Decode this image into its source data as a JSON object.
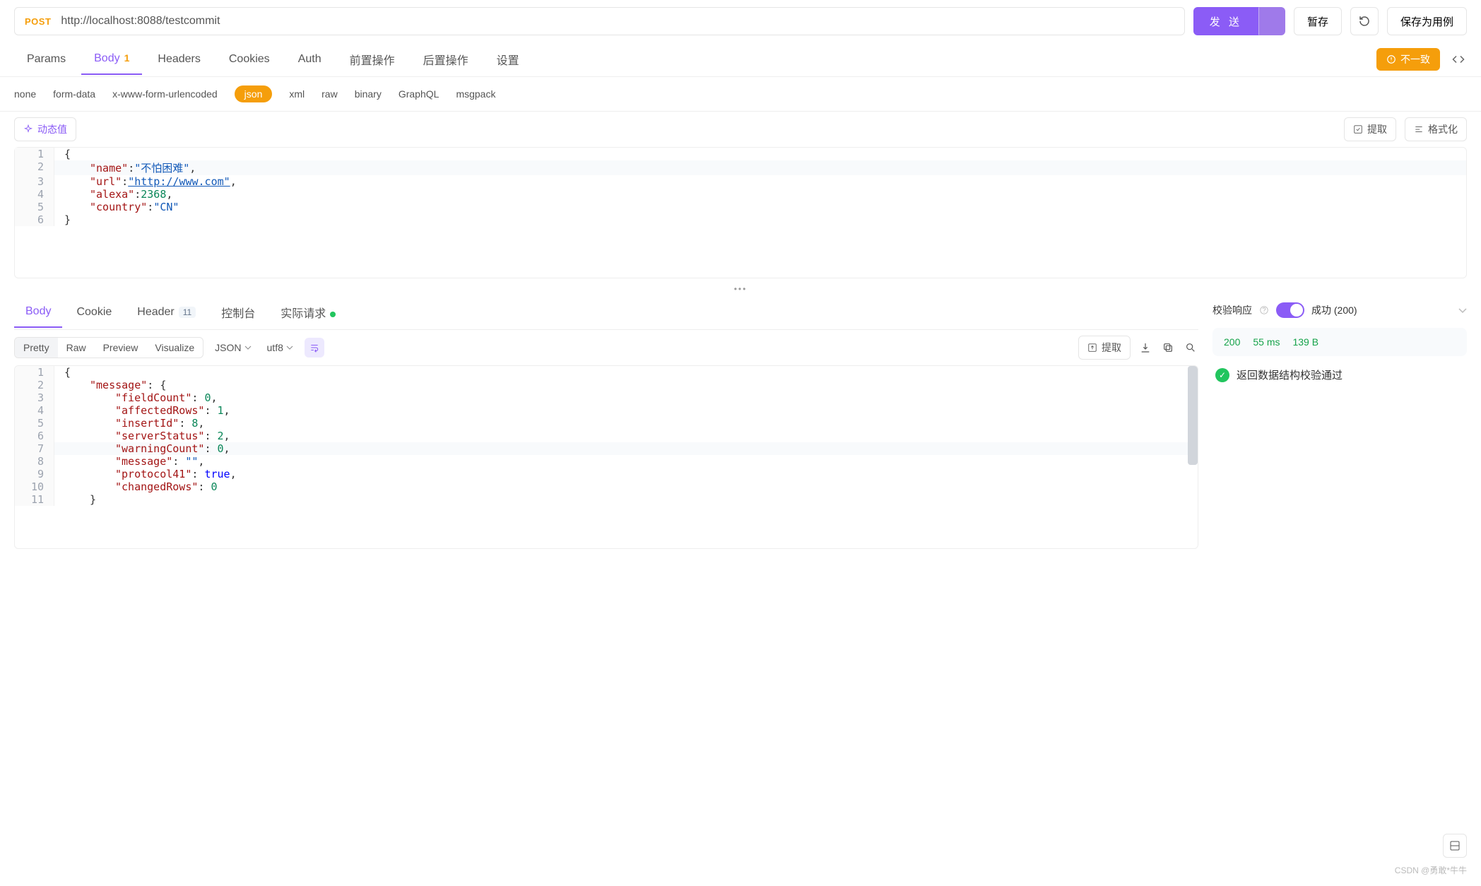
{
  "request": {
    "method": "POST",
    "url": "http://localhost:8088/testcommit"
  },
  "actions": {
    "send": "发 送",
    "save_draft": "暂存",
    "save_case": "保存为用例"
  },
  "reqTabs": {
    "params": "Params",
    "body": "Body",
    "body_badge": "1",
    "headers": "Headers",
    "cookies": "Cookies",
    "auth": "Auth",
    "pre": "前置操作",
    "post": "后置操作",
    "settings": "设置"
  },
  "warn_pill": "不一致",
  "bodyTypes": {
    "none": "none",
    "formdata": "form-data",
    "urlenc": "x-www-form-urlencoded",
    "json": "json",
    "xml": "xml",
    "raw": "raw",
    "binary": "binary",
    "graphql": "GraphQL",
    "msgpack": "msgpack"
  },
  "toolbar": {
    "dynamic": "动态值",
    "extract": "提取",
    "format": "格式化"
  },
  "reqBodyLines": [
    {
      "n": 1,
      "ind": 0,
      "tokens": [
        [
          "p",
          "{"
        ]
      ]
    },
    {
      "n": 2,
      "ind": 1,
      "hl": true,
      "tokens": [
        [
          "k",
          "\"name\""
        ],
        [
          "p",
          ":"
        ],
        [
          "s",
          "\"不怕困难\""
        ],
        [
          "p",
          ","
        ]
      ]
    },
    {
      "n": 3,
      "ind": 1,
      "tokens": [
        [
          "k",
          "\"url\""
        ],
        [
          "p",
          ":"
        ],
        [
          "s",
          "\"http://www.com\""
        ],
        [
          "p",
          ","
        ]
      ],
      "ul": true
    },
    {
      "n": 4,
      "ind": 1,
      "tokens": [
        [
          "k",
          "\"alexa\""
        ],
        [
          "p",
          ":"
        ],
        [
          "n",
          "2368"
        ],
        [
          "p",
          ","
        ]
      ]
    },
    {
      "n": 5,
      "ind": 1,
      "tokens": [
        [
          "k",
          "\"country\""
        ],
        [
          "p",
          ":"
        ],
        [
          "s",
          "\"CN\""
        ]
      ]
    },
    {
      "n": 6,
      "ind": 0,
      "tokens": [
        [
          "p",
          "}"
        ]
      ]
    }
  ],
  "respTabs": {
    "body": "Body",
    "cookie": "Cookie",
    "header": "Header",
    "header_badge": "11",
    "console": "控制台",
    "actual": "实际请求"
  },
  "respFmt": {
    "pretty": "Pretty",
    "raw": "Raw",
    "preview": "Preview",
    "visualize": "Visualize",
    "lang": "JSON",
    "enc": "utf8",
    "extract": "提取"
  },
  "respBodyLines": [
    {
      "n": 1,
      "ind": 0,
      "tokens": [
        [
          "p",
          "{"
        ]
      ]
    },
    {
      "n": 2,
      "ind": 1,
      "tokens": [
        [
          "k",
          "\"message\""
        ],
        [
          "p",
          ": {"
        ]
      ]
    },
    {
      "n": 3,
      "ind": 2,
      "tokens": [
        [
          "k",
          "\"fieldCount\""
        ],
        [
          "p",
          ": "
        ],
        [
          "n",
          "0"
        ],
        [
          "p",
          ","
        ]
      ]
    },
    {
      "n": 4,
      "ind": 2,
      "tokens": [
        [
          "k",
          "\"affectedRows\""
        ],
        [
          "p",
          ": "
        ],
        [
          "n",
          "1"
        ],
        [
          "p",
          ","
        ]
      ]
    },
    {
      "n": 5,
      "ind": 2,
      "tokens": [
        [
          "k",
          "\"insertId\""
        ],
        [
          "p",
          ": "
        ],
        [
          "n",
          "8"
        ],
        [
          "p",
          ","
        ]
      ]
    },
    {
      "n": 6,
      "ind": 2,
      "tokens": [
        [
          "k",
          "\"serverStatus\""
        ],
        [
          "p",
          ": "
        ],
        [
          "n",
          "2"
        ],
        [
          "p",
          ","
        ]
      ]
    },
    {
      "n": 7,
      "ind": 2,
      "hl": true,
      "tokens": [
        [
          "k",
          "\"warningCount\""
        ],
        [
          "p",
          ": "
        ],
        [
          "n",
          "0"
        ],
        [
          "p",
          ","
        ]
      ]
    },
    {
      "n": 8,
      "ind": 2,
      "tokens": [
        [
          "k",
          "\"message\""
        ],
        [
          "p",
          ": "
        ],
        [
          "s",
          "\"\""
        ],
        [
          "p",
          ","
        ]
      ]
    },
    {
      "n": 9,
      "ind": 2,
      "tokens": [
        [
          "k",
          "\"protocol41\""
        ],
        [
          "p",
          ": "
        ],
        [
          "b",
          "true"
        ],
        [
          "p",
          ","
        ]
      ]
    },
    {
      "n": 10,
      "ind": 2,
      "tokens": [
        [
          "k",
          "\"changedRows\""
        ],
        [
          "p",
          ": "
        ],
        [
          "n",
          "0"
        ]
      ]
    },
    {
      "n": 11,
      "ind": 1,
      "tokens": [
        [
          "p",
          "}"
        ]
      ]
    }
  ],
  "verify": {
    "title": "校验响应",
    "status_label": "成功 (200)"
  },
  "stats": {
    "code": "200",
    "time": "55 ms",
    "size": "139 B"
  },
  "validation_msg": "返回数据结构校验通过",
  "watermark": "CSDN @勇敢*牛牛"
}
